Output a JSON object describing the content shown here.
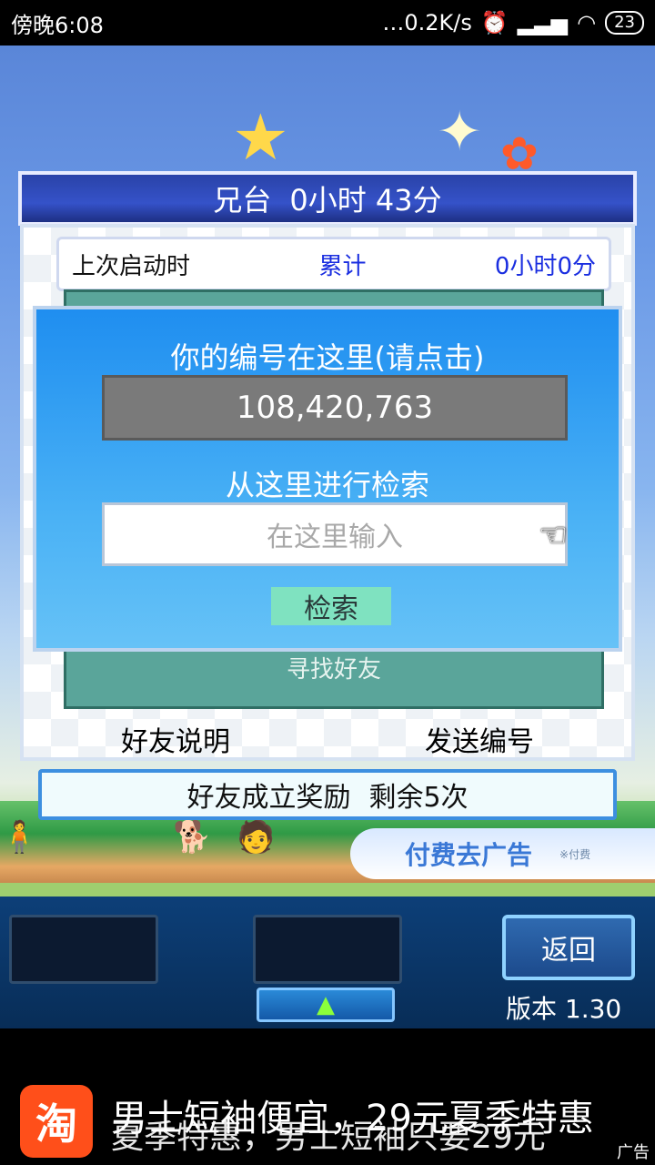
{
  "status_bar": {
    "time": "傍晚6:08",
    "network_speed": "…0.2K/s",
    "alarm_icon": "alarm-icon",
    "signal_icon": "signal-icon",
    "wifi_icon": "wifi-icon",
    "battery": "23"
  },
  "banner": {
    "name": "兄台",
    "time": "0小时 43分"
  },
  "panel": {
    "last_launch_label": "上次启动时",
    "total_label": "累计",
    "total_value": "0小时0分",
    "find_friend": "寻找好友",
    "friend_help": "好友说明",
    "send_id": "发送编号"
  },
  "reward": {
    "label": "好友成立奖励",
    "remaining": "剩余5次"
  },
  "pay_ad": {
    "label": "付费去广告",
    "note": "※付费"
  },
  "modal": {
    "title": "你的编号在这里(请点击)",
    "id_value": "108,420,763",
    "search_title": "从这里进行检索",
    "search_placeholder": "在这里输入",
    "search_button": "检索"
  },
  "bottom": {
    "back": "返回",
    "version": "版本 1.30"
  },
  "ad": {
    "logo_text": "淘",
    "line1": "男士短袖便宜，29元夏季特惠",
    "line2": "夏季特惠，男士短袖只要29元",
    "label": "广告"
  }
}
